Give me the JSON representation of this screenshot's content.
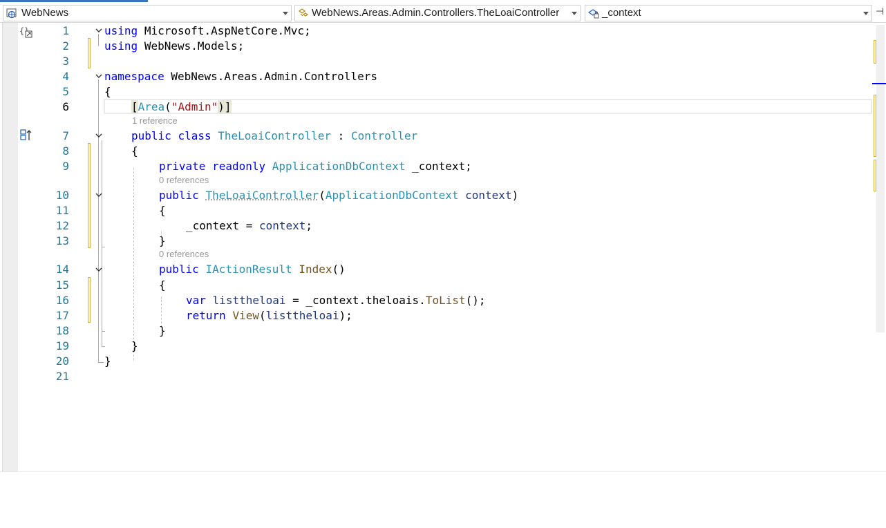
{
  "navbar": {
    "project": "WebNews",
    "type_scope": "WebNews.Areas.Admin.Controllers.TheLoaiController",
    "member": "_context",
    "project_icon": "csharp-project-icon",
    "type_icon": "class-icon",
    "member_icon": "field-icon",
    "split_icon": "split-editor-icon"
  },
  "editor": {
    "current_line": 6,
    "line_numbers": [
      "1",
      "2",
      "3",
      "4",
      "5",
      "6",
      "7",
      "8",
      "9",
      "10",
      "11",
      "12",
      "13",
      "14",
      "15",
      "16",
      "17",
      "18",
      "19",
      "20",
      "21"
    ],
    "lens": {
      "class_refs": "1 reference",
      "ctor_refs": "0 references",
      "index_refs": "0 references"
    },
    "tokens": {
      "using": "using",
      "ns1": "Microsoft.AspNetCore.Mvc;",
      "ns2": "WebNews.Models;",
      "namespace": "namespace",
      "ns_name": "WebNews.Areas.Admin.Controllers",
      "open_brace": "{",
      "close_brace": "}",
      "attr_open": "[",
      "area": "Area",
      "paren_open": "(",
      "admin_str": "\"Admin\"",
      "attr_close": ")]",
      "public": "public",
      "class": "class",
      "class_name": "TheLoaiController",
      "colon": ":",
      "base": "Controller",
      "private": "private",
      "readonly": "readonly",
      "dbctx": "ApplicationDbContext",
      "field": "_context;",
      "ctor": "TheLoaiController",
      "param": "context",
      "paren_close": ")",
      "assign_lhs": "_context = ",
      "assign_rhs": "context",
      "semi": ";",
      "iaction": "IActionResult",
      "index": "Index",
      "empty_parens": "()",
      "var": "var",
      "listvar": "listtheloai",
      "eq_ctx": " = _context.theloais.",
      "tolist": "ToList",
      "call_end": "();",
      "return": "return",
      "view": "View",
      "view_arg_open": "(",
      "view_arg_close": ");"
    }
  }
}
